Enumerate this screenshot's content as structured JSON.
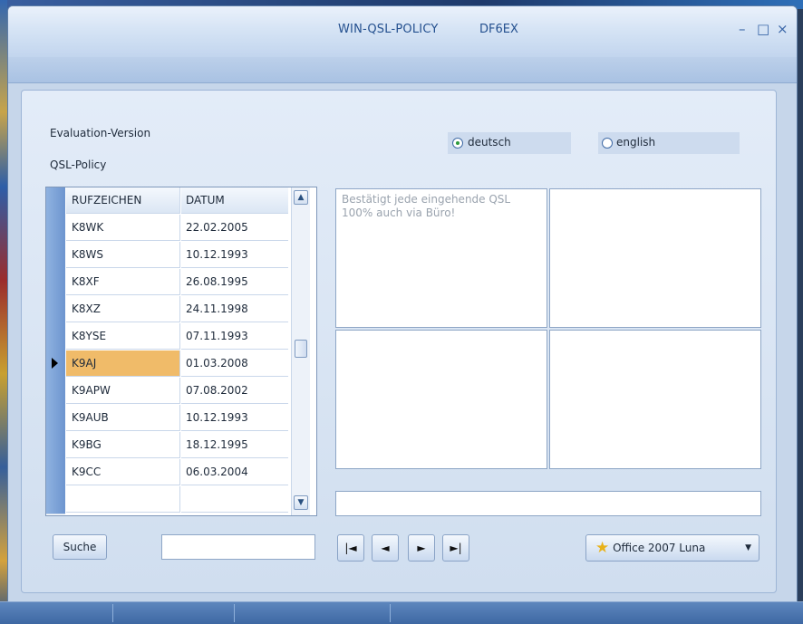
{
  "window": {
    "title": "WIN-QSL-POLICY",
    "callsign": "DF6EX",
    "minimize": "–",
    "maximize": "□",
    "close": "×"
  },
  "info": {
    "evaluation": "Evaluation-Version",
    "qsl_policy": "QSL-Policy"
  },
  "language": {
    "options": [
      {
        "label": "deutsch",
        "selected": true
      },
      {
        "label": "english",
        "selected": false
      }
    ]
  },
  "grid": {
    "columns": [
      "RUFZEICHEN",
      "DATUM"
    ],
    "rows": [
      [
        "K8WK",
        "22.02.2005"
      ],
      [
        "K8WS",
        "10.12.1993"
      ],
      [
        "K8XF",
        "26.08.1995"
      ],
      [
        "K8XZ",
        "24.11.1998"
      ],
      [
        "K8YSE",
        "07.11.1993"
      ],
      [
        "K9AJ",
        "01.03.2008"
      ],
      [
        "K9APW",
        "07.08.2002"
      ],
      [
        "K9AUB",
        "10.12.1993"
      ],
      [
        "K9BG",
        "18.12.1995"
      ],
      [
        "K9CC",
        "06.03.2004"
      ]
    ],
    "selected_index": 5
  },
  "policy": {
    "text": "Bestätigt jede eingehende QSL 100% auch via Büro!"
  },
  "search": {
    "button_label": "Suche",
    "value": ""
  },
  "navigation": {
    "first": "|◄",
    "prev": "◄",
    "next": "►",
    "last": "►|"
  },
  "theme": {
    "label": "Office 2007 Luna",
    "icon": "star-icon",
    "caret": "▼"
  },
  "colors": {
    "selected_row": "#f0bb69",
    "title_text": "#24508f",
    "accent_star": "#e8b21a"
  }
}
